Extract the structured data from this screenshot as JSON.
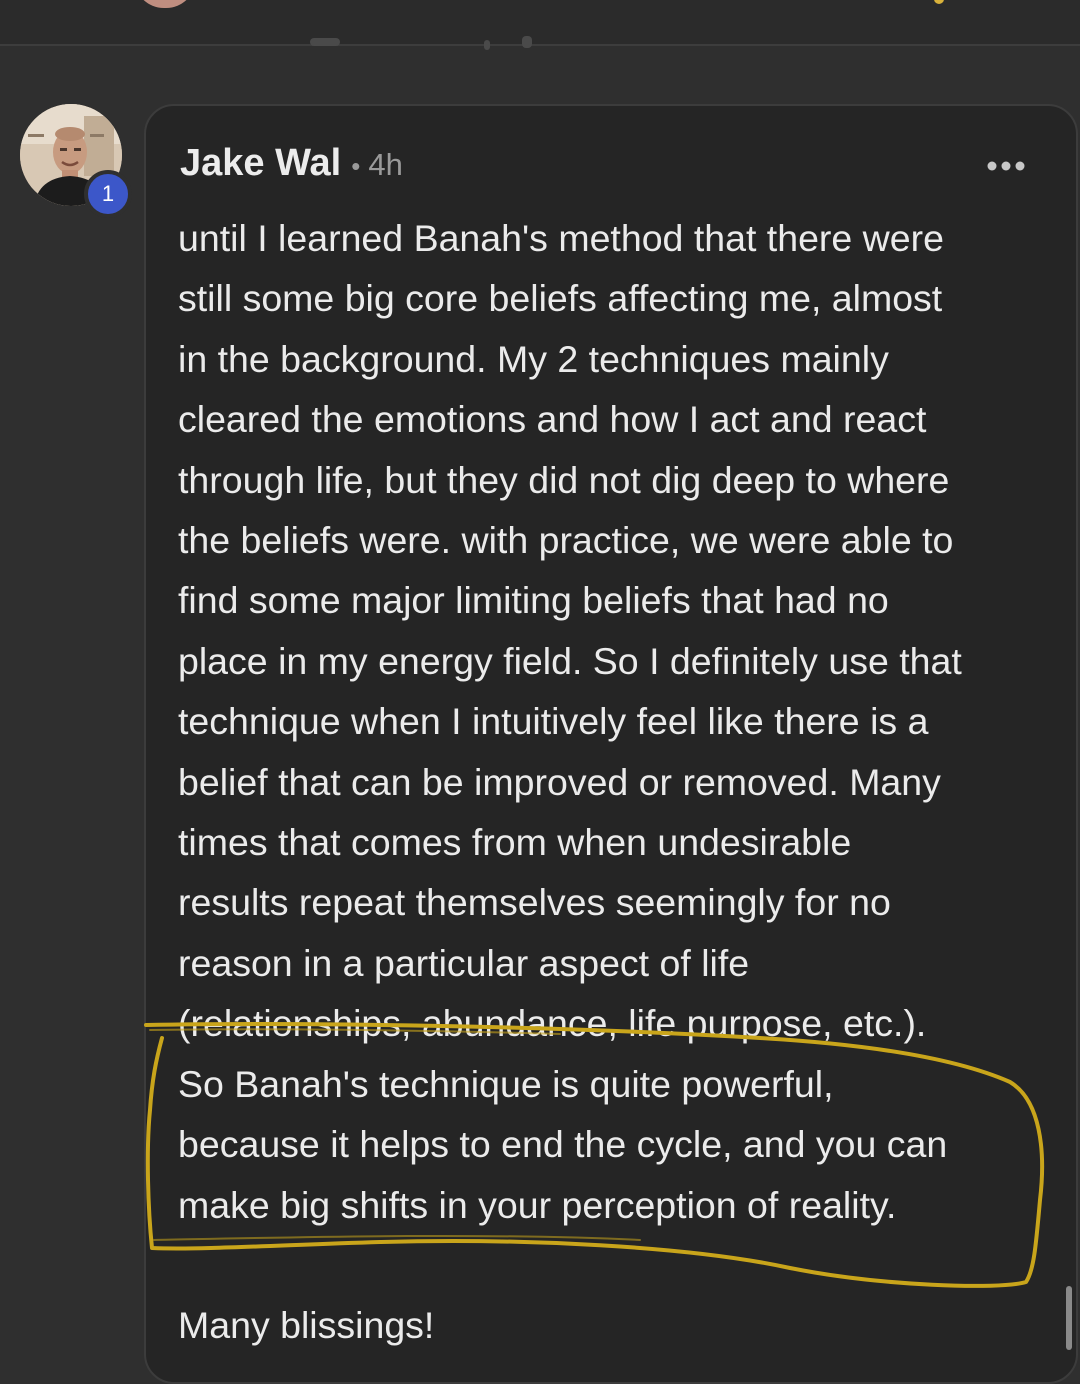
{
  "comment": {
    "author": "Jake Wal",
    "separator": "•",
    "time_ago": "4h",
    "avatar_badge": "1",
    "body": "until I learned Banah's method that there were\nstill some big core beliefs affecting me, almost\nin the background. My 2 techniques mainly\ncleared the emotions and how I act and react\nthrough life, but they did not dig deep to where\nthe beliefs were. with practice, we were able to\nfind some major limiting beliefs that had no\nplace in my energy field. So I definitely use that\ntechnique when I intuitively feel like there is a\nbelief that can be improved or removed. Many\ntimes that comes from when undesirable\nresults repeat themselves seemingly for no\nreason in a particular aspect of life\n(relationships, abundance, life purpose, etc.).\nSo Banah's technique is quite powerful,\nbecause it helps to end the cycle, and you can\nmake big shifts in your perception of reality.",
    "closing": "Many blissings!"
  },
  "icons": {
    "more": "more-options-icon",
    "avatar": "user-avatar"
  },
  "colors": {
    "background": "#2f2f2f",
    "card": "#252525",
    "text": "#ebebeb",
    "meta": "#9a9a9a",
    "badge": "#3c57c9",
    "highlight_marker": "#c9a51b"
  }
}
